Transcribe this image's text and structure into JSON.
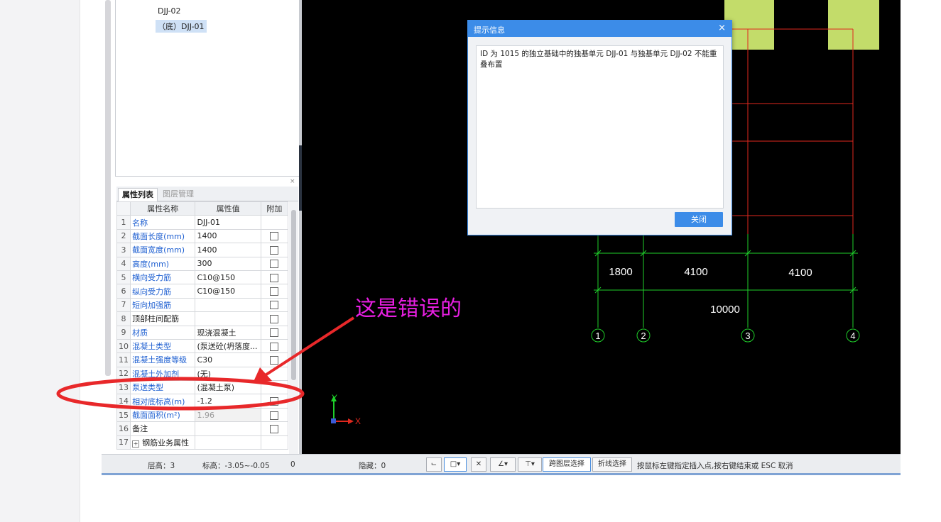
{
  "tree": {
    "items": [
      "DJJ-02",
      "（底）DJJ-01"
    ]
  },
  "panel_close": "×",
  "props": {
    "tabs": [
      "属性列表",
      "图层管理"
    ],
    "headers": [
      "属性名称",
      "属性值",
      "附加"
    ],
    "rows": [
      {
        "num": "1",
        "name": "名称",
        "value": "DJJ-01"
      },
      {
        "num": "2",
        "name": "截面长度(mm)",
        "value": "1400"
      },
      {
        "num": "3",
        "name": "截面宽度(mm)",
        "value": "1400"
      },
      {
        "num": "4",
        "name": "高度(mm)",
        "value": "300"
      },
      {
        "num": "5",
        "name": "横向受力筋",
        "value": "C10@150"
      },
      {
        "num": "6",
        "name": "纵向受力筋",
        "value": "C10@150"
      },
      {
        "num": "7",
        "name": "短向加强筋",
        "value": ""
      },
      {
        "num": "8",
        "name": "顶部柱间配筋",
        "value": ""
      },
      {
        "num": "9",
        "name": "材质",
        "value": "现浇混凝土"
      },
      {
        "num": "10",
        "name": "混凝土类型",
        "value": "(泵送砼(坍落度..."
      },
      {
        "num": "11",
        "name": "混凝土强度等级",
        "value": "C30"
      },
      {
        "num": "12",
        "name": "混凝土外加剂",
        "value": "(无)"
      },
      {
        "num": "13",
        "name": "泵送类型",
        "value": "(混凝土泵)"
      },
      {
        "num": "14",
        "name": "相对底标高(m)",
        "value": "-1.2"
      },
      {
        "num": "15",
        "name": "截面面积(m²)",
        "value": "1.96"
      },
      {
        "num": "16",
        "name": "备注",
        "value": ""
      },
      {
        "num": "17",
        "name": "钢筋业务属性",
        "value": ""
      }
    ]
  },
  "canvas": {
    "dims": [
      "1800",
      "4100",
      "4100",
      "10000"
    ],
    "axes": [
      "1",
      "2",
      "3",
      "4"
    ],
    "ucs": {
      "y": "Y",
      "x": "X"
    },
    "colors": {
      "grid_red": "#e0281e",
      "dim_green": "#1fcf2a",
      "foundation": "#c3dc6a"
    }
  },
  "dialog": {
    "title": "提示信息",
    "close": "×",
    "message": "ID 为 1015 的独立基础中的独基单元 DJJ-01 与独基单元 DJJ-02 不能重叠布置",
    "button": "关闭"
  },
  "status": {
    "floor_height": "层高：3",
    "elevation": "标高：-3.05~-0.05",
    "zero": "0",
    "hidden": "隐藏：0",
    "cross_layer": "跨图层选择",
    "polyline": "折线选择",
    "hint": "按鼠标左键指定插入点,按右键结束或 ESC 取消"
  },
  "annotation": {
    "text": "这是错误的",
    "color": "#e81fe2",
    "ellipse_color": "#e8282a"
  }
}
